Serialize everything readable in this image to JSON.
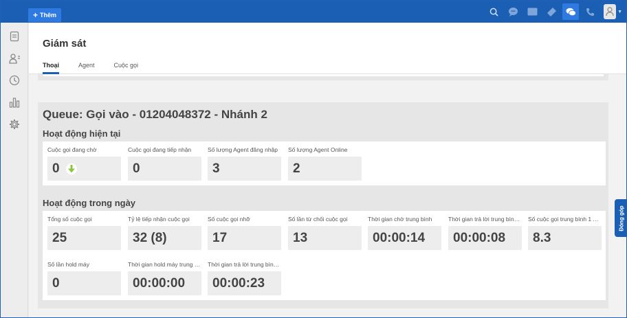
{
  "topbar": {
    "add_label": "Thêm"
  },
  "page": {
    "title": "Giám sát",
    "tabs": [
      "Thoại",
      "Agent",
      "Cuộc gọi"
    ]
  },
  "queue": {
    "title": "Queue: Gọi vào - 01204048372 - Nhánh 2",
    "current": {
      "title": "Hoạt động hiện tại",
      "metrics": [
        {
          "label": "Cuộc gọi đang chờ",
          "value": "0"
        },
        {
          "label": "Cuộc gọi đang tiếp nhận",
          "value": "0"
        },
        {
          "label": "Số lượng Agent đăng nhập",
          "value": "3"
        },
        {
          "label": "Số lượng Agent Online",
          "value": "2"
        }
      ]
    },
    "today": {
      "title": "Hoạt động trong ngày",
      "metrics": [
        {
          "label": "Tổng số cuộc gọi",
          "value": "25"
        },
        {
          "label": "Tỷ lệ tiếp nhận cuộc gọi",
          "value": "32 (8)"
        },
        {
          "label": "Số cuộc gọi nhỡ",
          "value": "17"
        },
        {
          "label": "Số lần từ chối cuộc gọi",
          "value": "13"
        },
        {
          "label": "Thời gian chờ trung bình",
          "value": "00:00:14"
        },
        {
          "label": "Thời gian trả lời trung bình ...",
          "value": "00:00:08"
        },
        {
          "label": "Số cuộc gọi trung bình 1 Ag...",
          "value": "8.3"
        },
        {
          "label": "Số lần hold máy",
          "value": "0"
        },
        {
          "label": "Thời gian hold máy trung bì...",
          "value": "00:00:00"
        },
        {
          "label": "Thời gian trả lời trung bình ...",
          "value": "00:00:23"
        }
      ]
    }
  },
  "feedback_label": "Đóng góp",
  "icons": {
    "top": [
      "search-icon",
      "chat-bubble-icon",
      "message-icon",
      "ticket-icon",
      "comments-icon",
      "phone-icon",
      "avatar-icon"
    ],
    "side": [
      "document-icon",
      "contacts-icon",
      "history-icon",
      "chart-icon",
      "gear-icon"
    ],
    "trend": "arrow-down-icon"
  },
  "colors": {
    "brand": "#1a5fb4",
    "accent": "#2f7ae0",
    "trend": "#8dc63f"
  }
}
